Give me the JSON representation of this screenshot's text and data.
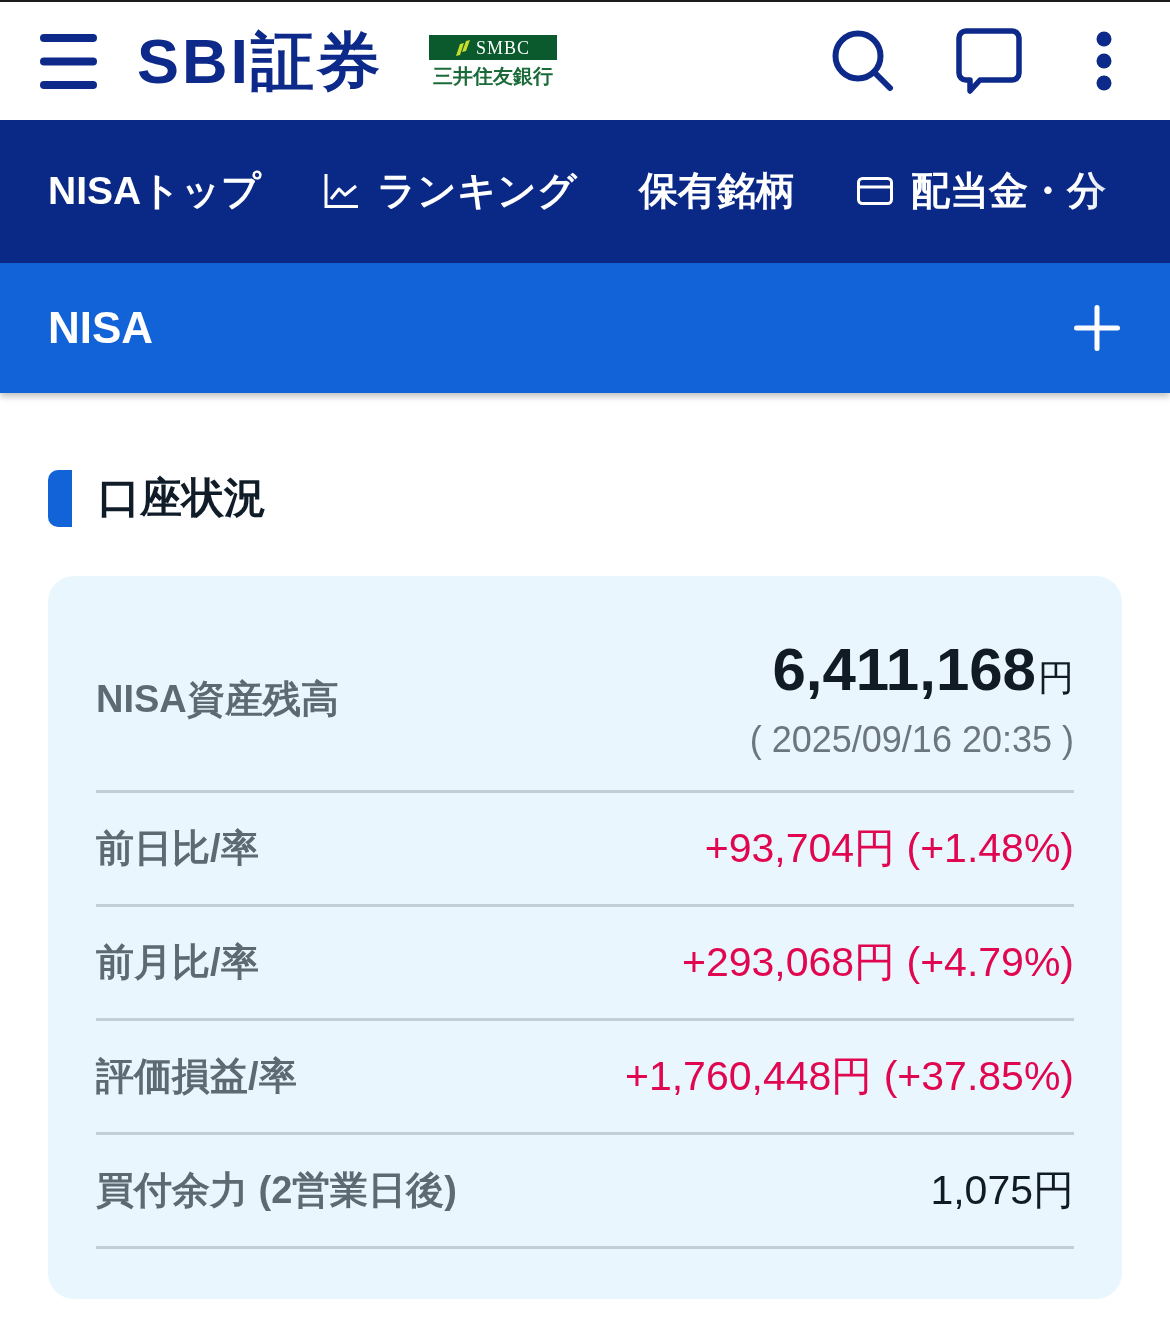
{
  "header": {
    "brand": "SBI証券",
    "partner_name": "SMBC",
    "partner_subtitle": "三井住友銀行"
  },
  "nav_tabs": [
    {
      "label": "NISAトップ"
    },
    {
      "label": "ランキング"
    },
    {
      "label": "保有銘柄"
    },
    {
      "label": "配当金・分"
    }
  ],
  "accordion": {
    "title": "NISA",
    "expanded": false
  },
  "section": {
    "title": "口座状況"
  },
  "balance": {
    "label": "NISA資産残高",
    "value": "6,411,168",
    "unit": "円",
    "as_of": "( 2025/09/16 20:35 )"
  },
  "rows": [
    {
      "label": "前日比/率",
      "value": "+93,704円 (+1.48%)",
      "kind": "gain"
    },
    {
      "label": "前月比/率",
      "value": "+293,068円 (+4.79%)",
      "kind": "gain"
    },
    {
      "label": "評価損益/率",
      "value": "+1,760,448円 (+37.85%)",
      "kind": "gain"
    },
    {
      "label": "買付余力 (2営業日後)",
      "value": "1,075円",
      "kind": "plain"
    }
  ]
}
